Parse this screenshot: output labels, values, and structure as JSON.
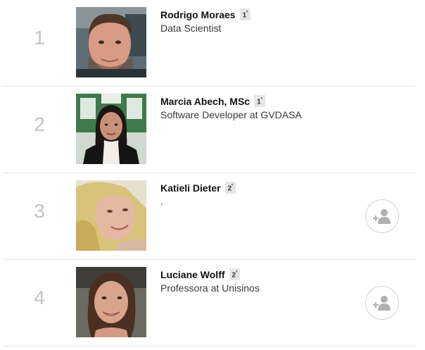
{
  "people": [
    {
      "rank": "1",
      "name": "Rodrigo Moraes",
      "degree": "1",
      "degree_suffix": "º",
      "headline": "Data Scientist",
      "connect": false
    },
    {
      "rank": "2",
      "name": "Marcia Abech, MSc",
      "degree": "1",
      "degree_suffix": "º",
      "headline": "Software Developer at GVDASA",
      "connect": false
    },
    {
      "rank": "3",
      "name": "Katieli Dieter",
      "degree": "2",
      "degree_suffix": "º",
      "headline": ".",
      "connect": true
    },
    {
      "rank": "4",
      "name": "Luciane Wolff",
      "degree": "2",
      "degree_suffix": "º",
      "headline": "Professora at Unisinos",
      "connect": true
    }
  ],
  "colors": {
    "rank": "#c4c4c4",
    "name": "#111111",
    "badge_bg": "#e6e6e6",
    "connect_icon": "#b0b0b0"
  },
  "icons": {
    "connect": "add-connection-icon"
  }
}
